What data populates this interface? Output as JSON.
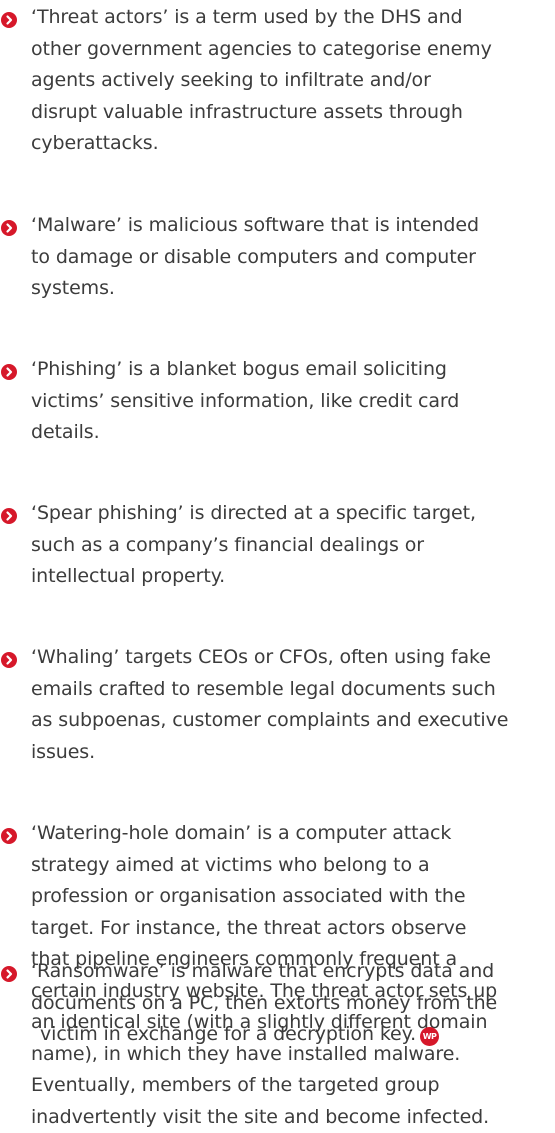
{
  "items": [
    {
      "lines": [
        "‘Threat actors’ is a term used by the DHS and",
        "other government agencies to categorise enemy",
        "agents actively seeking to infiltrate and/or",
        "disrupt valuable infrastructure assets through",
        "cyberattacks."
      ]
    },
    {
      "lines": [
        "‘Malware’ is malicious software that is intended",
        "to damage or disable computers and computer",
        "systems."
      ]
    },
    {
      "lines": [
        "‘Phishing’ is a blanket bogus email soliciting",
        "victims’ sensitive information, like credit card",
        "details."
      ]
    },
    {
      "lines": [
        "‘Spear phishing’ is directed at a specific target,",
        "such as a company’s financial dealings or",
        "intellectual property."
      ]
    },
    {
      "lines": [
        "‘Whaling’ targets CEOs or CFOs, often using fake",
        "emails crafted to resemble legal documents such",
        "as subpoenas, customer complaints and executive",
        "issues."
      ]
    },
    {
      "lines": [
        "‘Watering-hole domain’ is a computer attack",
        "strategy aimed at victims who belong to a",
        "profession or organisation associated with the",
        "target. For instance, the threat actors observe",
        "that pipeline engineers commonly frequent a",
        "certain industry website. The threat actor sets up",
        "an identical site (with a slightly different domain",
        "name), in which they have installed malware.",
        "Eventually, members of the targeted group",
        "inadvertently visit the site and become infected."
      ]
    },
    {
      "lines": [
        "‘Ransomware’ is malware that encrypts data and",
        "documents on a PC, then extorts money from the",
        "victim in exchange for a decryption key."
      ]
    }
  ],
  "end_mark": "WP",
  "colors": {
    "bullet": "#d6182a",
    "text": "#3c3c3c"
  }
}
